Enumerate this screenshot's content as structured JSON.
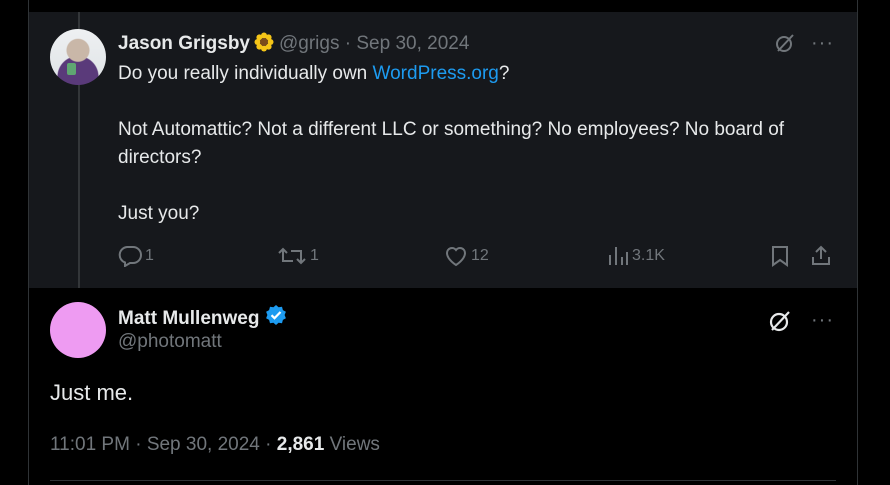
{
  "reply": {
    "author_name": "Jason Grigsby",
    "author_emoji": "sunflower",
    "handle": "@grigs",
    "separator": "·",
    "date": "Sep 30, 2024",
    "text_before_link": "Do you really individually own ",
    "link_text": "WordPress.org",
    "text_after_link": "?\n\nNot Automattic? Not a different LLC or something? No employees? No board of directors?\n\nJust you?",
    "actions": {
      "replies": "1",
      "reposts": "1",
      "likes": "12",
      "views": "3.1K"
    }
  },
  "main": {
    "author_name": "Matt Mullenweg",
    "verified": true,
    "handle": "@photomatt",
    "text": "Just me.",
    "time": "11:01 PM",
    "separator": "·",
    "date": "Sep 30, 2024",
    "views_count": "2,861",
    "views_label": "Views"
  },
  "more_label": "···",
  "colors": {
    "background": "#000000",
    "reply_background": "#16181c",
    "text": "#e7e9ea",
    "muted": "#71767b",
    "link": "#1d9bf0",
    "verified": "#1d9bf0",
    "matt_avatar": "#ee9bf2"
  },
  "icons": [
    "grok-icon",
    "more-icon",
    "reply-icon",
    "repost-icon",
    "like-icon",
    "views-icon",
    "bookmark-icon",
    "share-icon",
    "verified-badge-icon",
    "sunflower-icon"
  ]
}
